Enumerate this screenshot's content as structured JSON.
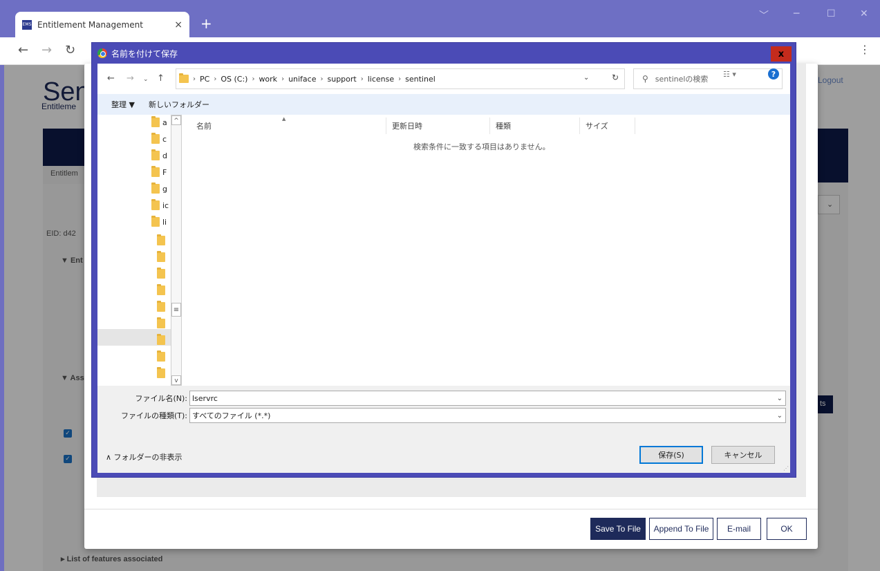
{
  "browser": {
    "tab_favicon": "EMS",
    "tab_title": "Entitlement Management",
    "tab_close": "×",
    "new_tab": "+",
    "win_minimize": "─",
    "win_restore": "☐",
    "win_close": "✕",
    "win_chevron": "﹀"
  },
  "page": {
    "brand": "Sen",
    "brand_sub": "Entitleme",
    "logout": "Logout",
    "tab_partial": "Entitlem",
    "eid_partial": "EID: d42",
    "section1": "▼ Ent",
    "section2": "▼ Ass",
    "features_link": "List of features associated",
    "button_partial": "ts"
  },
  "ems_modal": {
    "buttons": [
      "Save To File",
      "Append To File",
      "E-mail",
      "OK"
    ]
  },
  "dialog": {
    "title": "名前を付けて保存",
    "close": "x",
    "path": [
      "PC",
      "OS (C:)",
      "work",
      "uniface",
      "support",
      "license",
      "sentinel"
    ],
    "search_placeholder": "sentinelの検索",
    "organize": "整理 ▼",
    "new_folder": "新しいフォルダー",
    "tree_items": [
      "a",
      "c",
      "d",
      "F",
      "g",
      "ic",
      "li",
      "",
      "",
      "",
      "",
      "",
      "",
      "",
      "",
      ""
    ],
    "columns": [
      "名前",
      "更新日時",
      "種類",
      "サイズ"
    ],
    "empty_message": "検索条件に一致する項目はありません。",
    "filename_label": "ファイル名(N):",
    "filename_value": "lservrc",
    "filetype_label": "ファイルの種類(T):",
    "filetype_value": "すべてのファイル (*.*)",
    "hide_folders": "∧ フォルダーの非表示",
    "save_button": "保存(S)",
    "cancel_button": "キャンセル"
  }
}
